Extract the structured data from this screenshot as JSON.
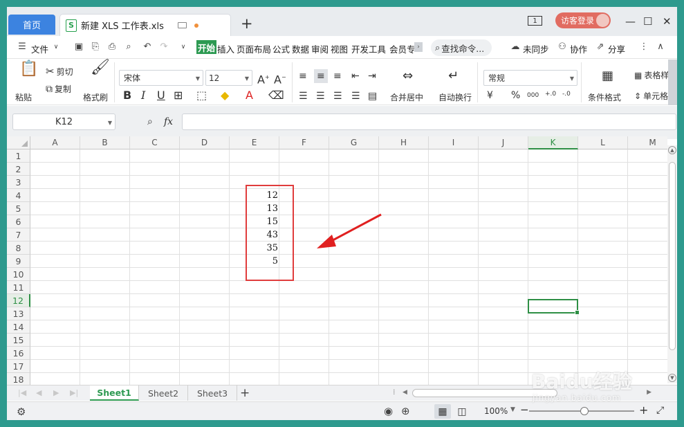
{
  "titlebar": {
    "home_tab": "首页",
    "file_tab": "新建 XLS 工作表.xls",
    "file_icon": "S",
    "new_tab": "+",
    "sheet_count": "1",
    "login": "访客登录",
    "minimize": "—",
    "maximize": "☐",
    "close": "✕"
  },
  "menubar": {
    "file": "文件",
    "tabs": [
      "开始",
      "插入",
      "页面布局",
      "公式",
      "数据",
      "审阅",
      "视图",
      "开发工具",
      "会员专"
    ],
    "search": "查找命令...",
    "sync": "未同步",
    "collab": "协作",
    "share": "分享"
  },
  "ribbon": {
    "paste": "粘贴",
    "cut": "剪切",
    "copy": "复制",
    "format_painter": "格式刷",
    "font_name": "宋体",
    "font_size": "12",
    "merge_center": "合并居中",
    "wrap_text": "自动换行",
    "number_format": "常规",
    "conditional_format": "条件格式",
    "table_style": "表格样",
    "cell": "单元格"
  },
  "formula": {
    "name_box": "K12",
    "fx": "fx",
    "value": ""
  },
  "grid": {
    "columns": [
      "A",
      "B",
      "C",
      "D",
      "E",
      "F",
      "G",
      "H",
      "I",
      "J",
      "K",
      "L",
      "M"
    ],
    "rows": [
      "1",
      "2",
      "3",
      "4",
      "5",
      "6",
      "7",
      "8",
      "9",
      "10",
      "11",
      "12",
      "13",
      "14",
      "15",
      "16",
      "17",
      "18"
    ],
    "selected_column": "K",
    "selected_row": "12",
    "column_e_values": [
      "12",
      "13",
      "15",
      "43",
      "35",
      "5"
    ]
  },
  "sheets": {
    "tabs": [
      "Sheet1",
      "Sheet2",
      "Sheet3"
    ],
    "active": "Sheet1",
    "add": "+"
  },
  "status": {
    "zoom": "100%"
  },
  "colors": {
    "accent": "#2e9a52",
    "home_tab": "#3c83e0",
    "login": "#e16c61",
    "highlight_box": "#e03c3c"
  },
  "watermark": {
    "main": "Baidu经验",
    "sub": "jingyan.baidu.com"
  }
}
